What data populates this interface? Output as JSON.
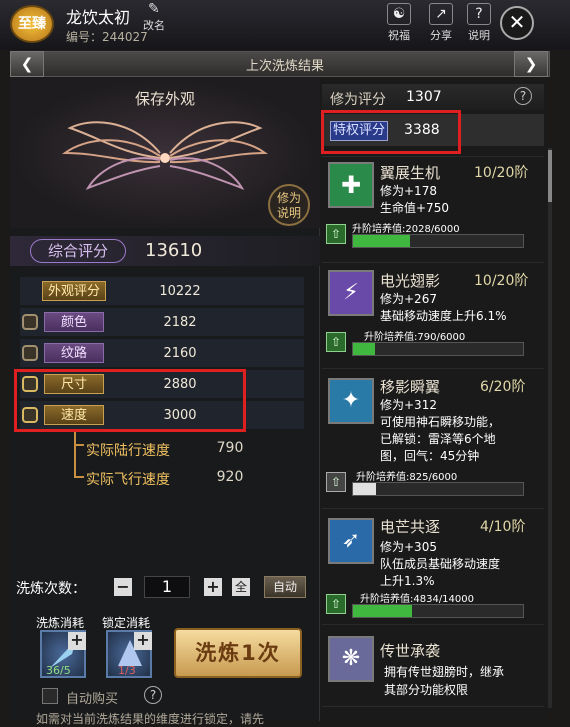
{
  "header": {
    "badge": "至臻",
    "player_name": "龙饮太初",
    "rename_label": "改名",
    "player_id": "编号：244027",
    "buttons": [
      {
        "label": "祝福",
        "icon": "blessing-icon"
      },
      {
        "label": "分享",
        "icon": "share-icon"
      },
      {
        "label": "说明",
        "icon": "help-icon"
      }
    ]
  },
  "titlebar": {
    "title": "上次洗炼结果"
  },
  "left": {
    "save_look": "保存外观",
    "xiuwei_button": "修为\n说明",
    "total_label": "综合评分",
    "total_value": "13610",
    "attributes": [
      {
        "label": "外观评分",
        "value": "10222",
        "locked": false
      },
      {
        "label": "颜色",
        "value": "2182",
        "locked": true
      },
      {
        "label": "纹路",
        "value": "2160",
        "locked": true
      },
      {
        "label": "尺寸",
        "value": "2880",
        "locked": true
      },
      {
        "label": "速度",
        "value": "3000",
        "locked": true
      }
    ],
    "speeds": [
      {
        "label": "实际陆行速度",
        "value": "790"
      },
      {
        "label": "实际飞行速度",
        "value": "920"
      }
    ],
    "refine_count_label": "洗炼次数：",
    "refine_count": "1",
    "all_label": "全",
    "auto_label": "自动",
    "consume_label": "洗炼消耗",
    "lock_consume_label": "锁定消耗",
    "consume_count": "36/5",
    "lock_count": "1/3",
    "refine_button": "洗炼1次",
    "auto_buy_label": "自动购买",
    "notice": "如需对当前洗炼结果的维度进行锁定，请先"
  },
  "right": {
    "score_label": "修为评分",
    "score_value": "1307",
    "privilege_label": "特权评分",
    "privilege_value": "3388",
    "skills": [
      {
        "name": "翼展生机",
        "level": "10/20阶",
        "desc": [
          "修为+178",
          "生命值+750"
        ],
        "progress_text": "升阶培养值:2028/6000",
        "progress": 0.338,
        "icon_color": "#2a8a4a",
        "grey": false
      },
      {
        "name": "电光翅影",
        "level": "10/20阶",
        "desc": [
          "修为+267",
          "基础移动速度上升6.1%"
        ],
        "progress_text": "升阶培养值:790/6000",
        "progress": 0.132,
        "icon_color": "#6a4aa8",
        "grey": false
      },
      {
        "name": "移影瞬翼",
        "level": "6/20阶",
        "desc": [
          "修为+312",
          "可使用神石瞬移功能，",
          "已解锁：雷泽等6个地",
          "图，回气：45分钟"
        ],
        "progress_text": "升阶培养值:825/6000",
        "progress": 0.1375,
        "icon_color": "#2a7aa8",
        "grey": true
      },
      {
        "name": "电芒共逐",
        "level": "4/10阶",
        "desc": [
          "修为+305",
          "队伍成员基础移动速度",
          "上升1.3%"
        ],
        "progress_text": "升阶培养值:4834/14000",
        "progress": 0.345,
        "icon_color": "#2a6aa8",
        "grey": false
      },
      {
        "name": "传世承袭",
        "level": "",
        "desc": [
          "拥有传世翅膀时，继承",
          "其部分功能权限"
        ],
        "progress_text": "",
        "progress": 0,
        "icon_color": "#6a6a9a",
        "grey": false
      }
    ]
  }
}
